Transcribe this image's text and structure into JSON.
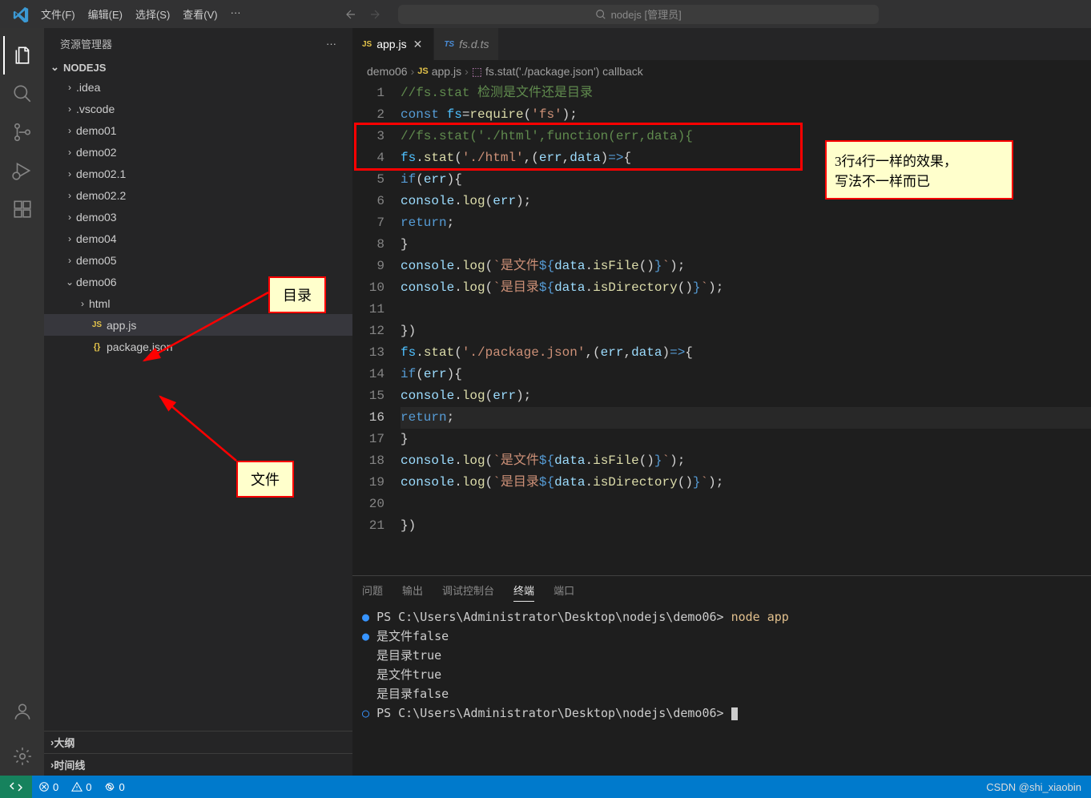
{
  "menu": {
    "file": "文件(F)",
    "edit": "编辑(E)",
    "select": "选择(S)",
    "view": "查看(V)",
    "more": "···"
  },
  "search": {
    "text": "nodejs [管理员]"
  },
  "sidebar": {
    "title": "资源管理器",
    "project": "NODEJS",
    "items": [
      {
        "name": ".idea",
        "type": "folder",
        "depth": 1,
        "expanded": false
      },
      {
        "name": ".vscode",
        "type": "folder",
        "depth": 1,
        "expanded": false
      },
      {
        "name": "demo01",
        "type": "folder",
        "depth": 1,
        "expanded": false
      },
      {
        "name": "demo02",
        "type": "folder",
        "depth": 1,
        "expanded": false
      },
      {
        "name": "demo02.1",
        "type": "folder",
        "depth": 1,
        "expanded": false
      },
      {
        "name": "demo02.2",
        "type": "folder",
        "depth": 1,
        "expanded": false
      },
      {
        "name": "demo03",
        "type": "folder",
        "depth": 1,
        "expanded": false
      },
      {
        "name": "demo04",
        "type": "folder",
        "depth": 1,
        "expanded": false
      },
      {
        "name": "demo05",
        "type": "folder",
        "depth": 1,
        "expanded": false
      },
      {
        "name": "demo06",
        "type": "folder",
        "depth": 1,
        "expanded": true
      },
      {
        "name": "html",
        "type": "folder",
        "depth": 2,
        "expanded": false
      },
      {
        "name": "app.js",
        "type": "js",
        "depth": 2,
        "active": true
      },
      {
        "name": "package.json",
        "type": "json",
        "depth": 2
      }
    ],
    "outline": "大纲",
    "timeline": "时间线"
  },
  "tabs": [
    {
      "label": "app.js",
      "icon": "JS",
      "active": true
    },
    {
      "label": "fs.d.ts",
      "icon": "TS",
      "active": false
    }
  ],
  "breadcrumb": {
    "p1": "demo06",
    "p2": "app.js",
    "p3": "fs.stat('./package.json') callback"
  },
  "code": {
    "lines": [
      {
        "n": 1,
        "html": "<span class='tok-comment'>//fs.stat </span><span class='tok-cn'>检测是文件还是目录</span>"
      },
      {
        "n": 2,
        "html": "<span class='tok-keyword'>const </span><span class='tok-var'>fs</span><span class='tok-punct'>=</span><span class='tok-func'>require</span><span class='tok-punct'>(</span><span class='tok-string'>'fs'</span><span class='tok-punct'>);</span>"
      },
      {
        "n": 3,
        "html": "<span class='tok-comment'>//fs.stat('./html',function(err,data){</span>"
      },
      {
        "n": 4,
        "html": "    <span class='tok-var'>fs</span><span class='tok-punct'>.</span><span class='tok-func'>stat</span><span class='tok-punct'>(</span><span class='tok-string'>'./html'</span><span class='tok-punct'>,(</span><span class='tok-param'>err</span><span class='tok-punct'>,</span><span class='tok-param'>data</span><span class='tok-punct'>)</span><span class='tok-keyword'>=></span><span class='tok-punct'>{</span>"
      },
      {
        "n": 5,
        "html": "    <span class='tok-keyword'>if</span><span class='tok-punct'>(</span><span class='tok-param'>err</span><span class='tok-punct'>){</span>"
      },
      {
        "n": 6,
        "html": "        <span class='tok-prop'>console</span><span class='tok-punct'>.</span><span class='tok-func'>log</span><span class='tok-punct'>(</span><span class='tok-param'>err</span><span class='tok-punct'>);</span>"
      },
      {
        "n": 7,
        "html": "        <span class='tok-keyword'>return</span><span class='tok-punct'>;</span>"
      },
      {
        "n": 8,
        "html": "    <span class='tok-punct'>}</span>"
      },
      {
        "n": 9,
        "html": "    <span class='tok-prop'>console</span><span class='tok-punct'>.</span><span class='tok-func'>log</span><span class='tok-punct'>(</span><span class='tok-string'>`</span><span class='tok-cn2'>是文件</span><span class='tok-keyword'>${</span><span class='tok-param'>data</span><span class='tok-punct'>.</span><span class='tok-func'>isFile</span><span class='tok-punct'>()</span><span class='tok-keyword'>}</span><span class='tok-string'>`</span><span class='tok-punct'>);</span>"
      },
      {
        "n": 10,
        "html": "    <span class='tok-prop'>console</span><span class='tok-punct'>.</span><span class='tok-func'>log</span><span class='tok-punct'>(</span><span class='tok-string'>`</span><span class='tok-cn2'>是目录</span><span class='tok-keyword'>${</span><span class='tok-param'>data</span><span class='tok-punct'>.</span><span class='tok-func'>isDirectory</span><span class='tok-punct'>()</span><span class='tok-keyword'>}</span><span class='tok-string'>`</span><span class='tok-punct'>);</span>"
      },
      {
        "n": 11,
        "html": ""
      },
      {
        "n": 12,
        "html": "<span class='tok-punct'>})</span>"
      },
      {
        "n": 13,
        "html": "    <span class='tok-var'>fs</span><span class='tok-punct'>.</span><span class='tok-func'>stat</span><span class='tok-punct'>(</span><span class='tok-string'>'./package.json'</span><span class='tok-punct'>,(</span><span class='tok-param'>err</span><span class='tok-punct'>,</span><span class='tok-param'>data</span><span class='tok-punct'>)</span><span class='tok-keyword'>=></span><span class='tok-punct'>{</span>"
      },
      {
        "n": 14,
        "html": "    <span class='tok-keyword'>if</span><span class='tok-punct'>(</span><span class='tok-param'>err</span><span class='tok-punct'>){</span>"
      },
      {
        "n": 15,
        "html": "        <span class='tok-prop'>console</span><span class='tok-punct'>.</span><span class='tok-func'>log</span><span class='tok-punct'>(</span><span class='tok-param'>err</span><span class='tok-punct'>);</span>"
      },
      {
        "n": 16,
        "html": "        <span class='tok-keyword'>return</span><span class='tok-punct'>;</span>",
        "active": true
      },
      {
        "n": 17,
        "html": "    <span class='tok-punct'>}</span>"
      },
      {
        "n": 18,
        "html": "    <span class='tok-prop'>console</span><span class='tok-punct'>.</span><span class='tok-func'>log</span><span class='tok-punct'>(</span><span class='tok-string'>`</span><span class='tok-cn2'>是文件</span><span class='tok-keyword'>${</span><span class='tok-param'>data</span><span class='tok-punct'>.</span><span class='tok-func'>isFile</span><span class='tok-punct'>()</span><span class='tok-keyword'>}</span><span class='tok-string'>`</span><span class='tok-punct'>);</span>"
      },
      {
        "n": 19,
        "html": "    <span class='tok-prop'>console</span><span class='tok-punct'>.</span><span class='tok-func'>log</span><span class='tok-punct'>(</span><span class='tok-string'>`</span><span class='tok-cn2'>是目录</span><span class='tok-keyword'>${</span><span class='tok-param'>data</span><span class='tok-punct'>.</span><span class='tok-func'>isDirectory</span><span class='tok-punct'>()</span><span class='tok-keyword'>}</span><span class='tok-string'>`</span><span class='tok-punct'>);</span>"
      },
      {
        "n": 20,
        "html": ""
      },
      {
        "n": 21,
        "html": "<span class='tok-punct'>})</span>"
      }
    ]
  },
  "panel": {
    "tabs": {
      "problems": "问题",
      "output": "输出",
      "debug": "调试控制台",
      "terminal": "终端",
      "ports": "端口"
    }
  },
  "terminal": {
    "lines": [
      {
        "bullet": "●",
        "prompt": "PS C:\\Users\\Administrator\\Desktop\\nodejs\\demo06> ",
        "cmd": "node app"
      },
      {
        "bullet": "●",
        "text": "是文件false"
      },
      {
        "text": "是目录true"
      },
      {
        "text": "是文件true"
      },
      {
        "text": "是目录false"
      },
      {
        "bullet": "○",
        "prompt": "PS C:\\Users\\Administrator\\Desktop\\nodejs\\demo06> ",
        "cursor": true
      }
    ]
  },
  "status": {
    "errors": "0",
    "warnings": "0",
    "ports": "0",
    "watermark": "CSDN @shi_xiaobin"
  },
  "annotations": {
    "a1": "目录",
    "a2": "文件",
    "a3_l1": "3行4行一样的效果，",
    "a3_l2": "写法不一样而已"
  }
}
